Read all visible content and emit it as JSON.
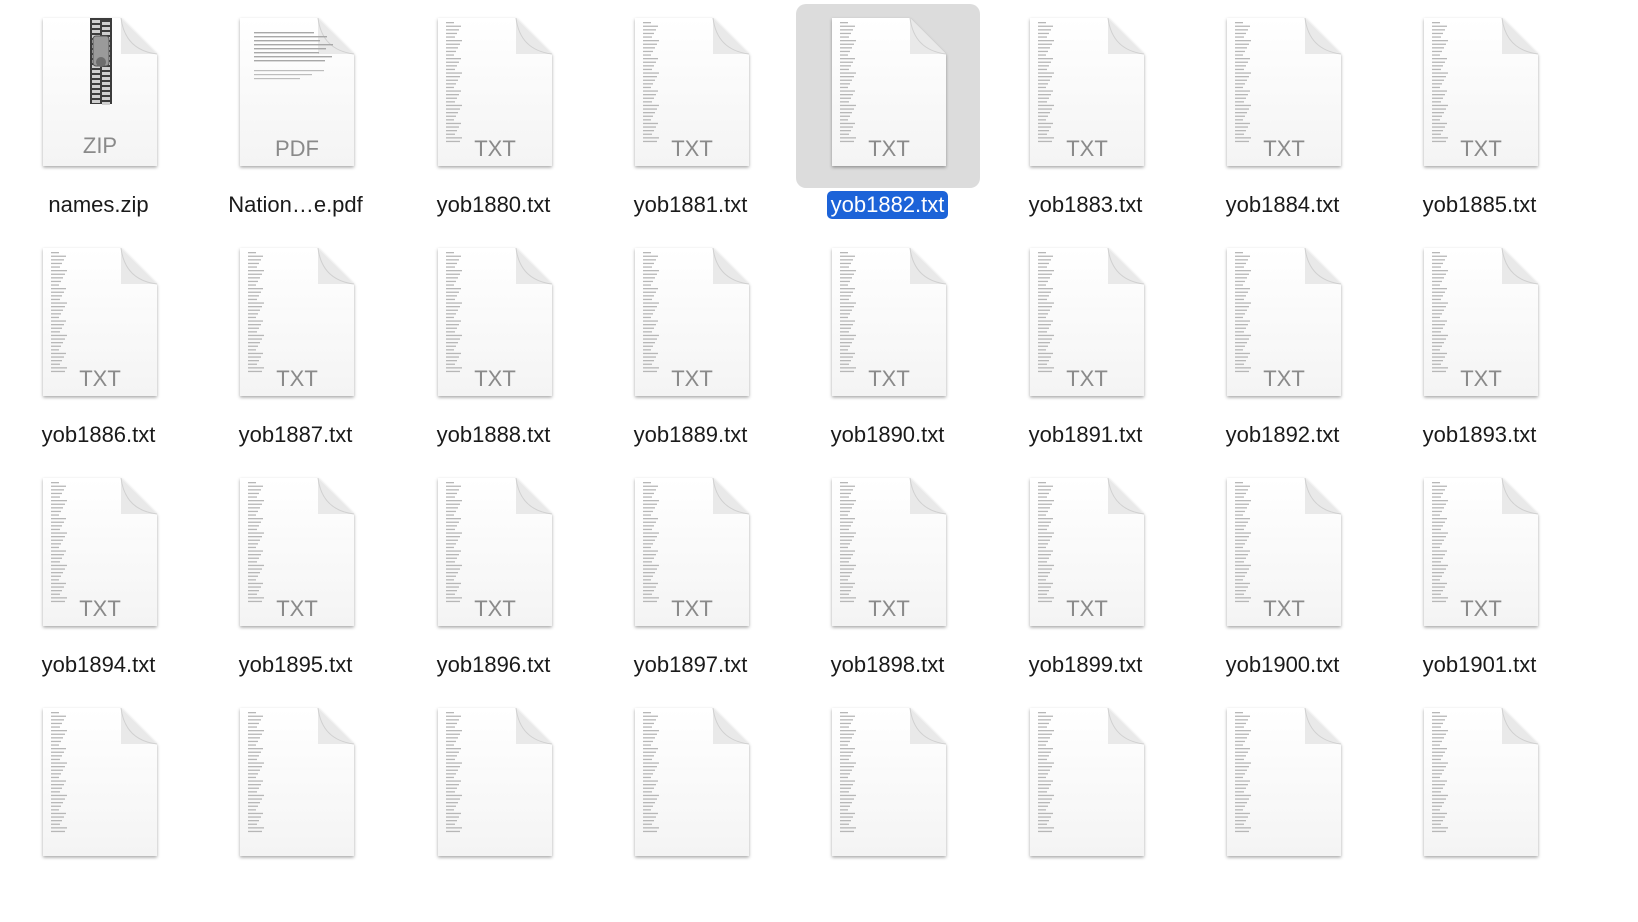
{
  "selection_color": "#1c63d8",
  "files": [
    {
      "name": "names.zip",
      "kind": "ZIP",
      "icon": "zip-archive-icon",
      "selected": false
    },
    {
      "name": "Nation…e.pdf",
      "kind": "PDF",
      "icon": "pdf-document-icon",
      "selected": false
    },
    {
      "name": "yob1880.txt",
      "kind": "TXT",
      "icon": "text-document-icon",
      "selected": false
    },
    {
      "name": "yob1881.txt",
      "kind": "TXT",
      "icon": "text-document-icon",
      "selected": false
    },
    {
      "name": "yob1882.txt",
      "kind": "TXT",
      "icon": "text-document-icon",
      "selected": true
    },
    {
      "name": "yob1883.txt",
      "kind": "TXT",
      "icon": "text-document-icon",
      "selected": false
    },
    {
      "name": "yob1884.txt",
      "kind": "TXT",
      "icon": "text-document-icon",
      "selected": false
    },
    {
      "name": "yob1885.txt",
      "kind": "TXT",
      "icon": "text-document-icon",
      "selected": false
    },
    {
      "name": "yob1886.txt",
      "kind": "TXT",
      "icon": "text-document-icon",
      "selected": false
    },
    {
      "name": "yob1887.txt",
      "kind": "TXT",
      "icon": "text-document-icon",
      "selected": false
    },
    {
      "name": "yob1888.txt",
      "kind": "TXT",
      "icon": "text-document-icon",
      "selected": false
    },
    {
      "name": "yob1889.txt",
      "kind": "TXT",
      "icon": "text-document-icon",
      "selected": false
    },
    {
      "name": "yob1890.txt",
      "kind": "TXT",
      "icon": "text-document-icon",
      "selected": false
    },
    {
      "name": "yob1891.txt",
      "kind": "TXT",
      "icon": "text-document-icon",
      "selected": false
    },
    {
      "name": "yob1892.txt",
      "kind": "TXT",
      "icon": "text-document-icon",
      "selected": false
    },
    {
      "name": "yob1893.txt",
      "kind": "TXT",
      "icon": "text-document-icon",
      "selected": false
    },
    {
      "name": "yob1894.txt",
      "kind": "TXT",
      "icon": "text-document-icon",
      "selected": false
    },
    {
      "name": "yob1895.txt",
      "kind": "TXT",
      "icon": "text-document-icon",
      "selected": false
    },
    {
      "name": "yob1896.txt",
      "kind": "TXT",
      "icon": "text-document-icon",
      "selected": false
    },
    {
      "name": "yob1897.txt",
      "kind": "TXT",
      "icon": "text-document-icon",
      "selected": false
    },
    {
      "name": "yob1898.txt",
      "kind": "TXT",
      "icon": "text-document-icon",
      "selected": false
    },
    {
      "name": "yob1899.txt",
      "kind": "TXT",
      "icon": "text-document-icon",
      "selected": false
    },
    {
      "name": "yob1900.txt",
      "kind": "TXT",
      "icon": "text-document-icon",
      "selected": false
    },
    {
      "name": "yob1901.txt",
      "kind": "TXT",
      "icon": "text-document-icon",
      "selected": false
    },
    {
      "name": "",
      "kind": "",
      "icon": "text-document-icon",
      "selected": false
    },
    {
      "name": "",
      "kind": "",
      "icon": "text-document-icon",
      "selected": false
    },
    {
      "name": "",
      "kind": "",
      "icon": "text-document-icon",
      "selected": false
    },
    {
      "name": "",
      "kind": "",
      "icon": "text-document-icon",
      "selected": false
    },
    {
      "name": "",
      "kind": "",
      "icon": "text-document-icon",
      "selected": false
    },
    {
      "name": "",
      "kind": "",
      "icon": "text-document-icon",
      "selected": false
    },
    {
      "name": "",
      "kind": "",
      "icon": "text-document-icon",
      "selected": false
    },
    {
      "name": "",
      "kind": "",
      "icon": "text-document-icon",
      "selected": false
    }
  ]
}
